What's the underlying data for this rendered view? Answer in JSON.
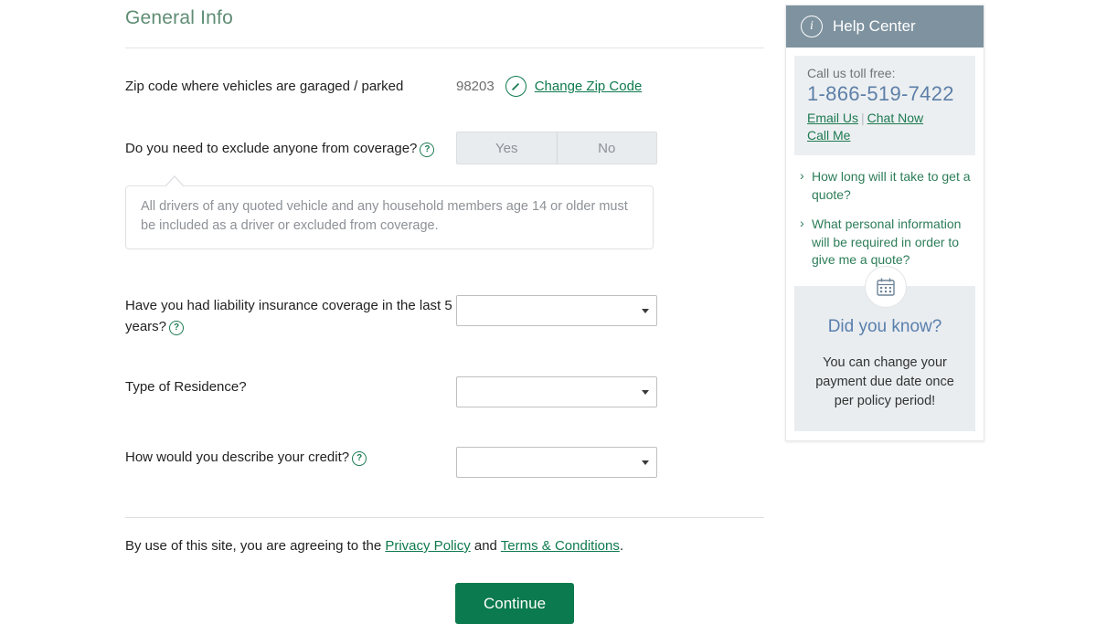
{
  "form": {
    "section_title": "General Info",
    "zip": {
      "label": "Zip code where vehicles are garaged / parked",
      "value": "98203",
      "edit_link": "Change Zip Code",
      "edit_icon": "pencil-circle-icon"
    },
    "exclude": {
      "label": "Do you need to exclude anyone from coverage?",
      "help_icon": "?",
      "yes_label": "Yes",
      "no_label": "No",
      "callout": "All drivers of any quoted vehicle and any household members age 14 or older must be included as a driver or excluded from coverage."
    },
    "liability": {
      "label": "Have you had liability insurance coverage in the last 5 years?",
      "help_icon": "?",
      "value": ""
    },
    "residence": {
      "label": "Type of Residence?",
      "value": ""
    },
    "credit": {
      "label": "How would you describe your credit?",
      "help_icon": "?",
      "value": ""
    },
    "terms": {
      "prefix": "By use of this site, you are agreeing to the ",
      "privacy_link": "Privacy Policy",
      "middle": " and ",
      "terms_link": "Terms & Conditions",
      "suffix": "."
    },
    "continue_label": "Continue"
  },
  "sidebar": {
    "header": {
      "title": "Help Center",
      "icon": "info-circle-icon"
    },
    "contact": {
      "toll_free_label": "Call us toll free:",
      "phone": "1-866-519-7422",
      "email_link": "Email Us",
      "chat_link": "Chat Now",
      "call_link": "Call Me"
    },
    "faq": [
      "How long will it take to get a quote?",
      "What personal information will be required in order to give me a quote?"
    ],
    "did_you_know": {
      "icon": "calendar-icon",
      "title": "Did you know?",
      "text": "You can change your payment due date once per policy period!"
    }
  },
  "colors": {
    "brand_green": "#0b7a4e",
    "link_green": "#1d7a52",
    "heading_green": "#5f8d74",
    "help_header": "#7e929f",
    "phone_blue": "#5d7fa8",
    "dyk_blue": "#5a7fad"
  }
}
